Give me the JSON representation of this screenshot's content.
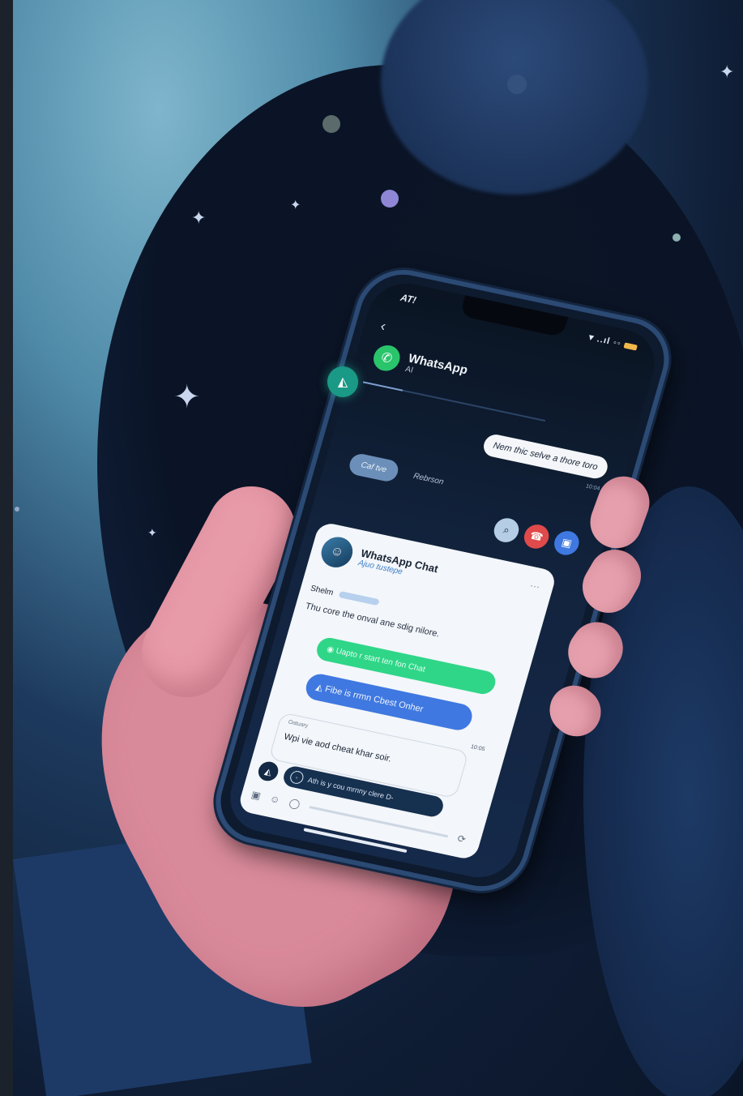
{
  "status_bar": {
    "carrier": "AT!",
    "right": "▾ ..ıl ◦◦"
  },
  "header": {
    "back_glyph": "‹",
    "title": "WhatsApp",
    "subtitle": "AI"
  },
  "chat": {
    "outgoing_message": "Nem thic selve a thore toro",
    "outgoing_time": "10:04",
    "chip_label": "Caf tve",
    "chip_caption": "Rebrson"
  },
  "actions": [
    {
      "icon": "search-icon",
      "glyph": "⌕",
      "color": "#b6cde6"
    },
    {
      "icon": "call-icon",
      "glyph": "☎",
      "color": "#e04a4a"
    },
    {
      "icon": "video-icon",
      "glyph": "▣",
      "color": "#3f78e0"
    }
  ],
  "card": {
    "title": "WhatsApp Chat",
    "subtitle": "Ajuo tustepe",
    "more_glyph": "···",
    "label": "Shelm",
    "description": "Thu core the onval ane sdig nilore.",
    "green_message": "Uapto r start ten fon Chat",
    "blue_message": "Fibe is rrmn Cbest Onher",
    "message_time": "10:05",
    "quote_label": "Oatuary",
    "quote_text": "Wpi vie aod cheat khar soir.",
    "composer_text": "Ath is y cou mrnny clere D-",
    "composer_glyph": "⟳"
  },
  "float_button": {
    "icon": "bell-icon",
    "glyph": "◭"
  },
  "colors": {
    "accent_green": "#2fd688",
    "accent_blue": "#3f78e0",
    "whatsapp_green": "#2ac46b",
    "float_teal": "#1a9a86"
  }
}
